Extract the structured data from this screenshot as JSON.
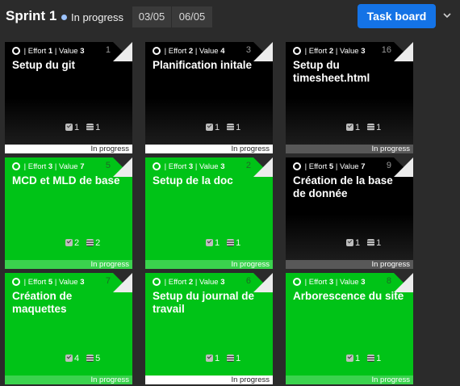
{
  "header": {
    "title": "Sprint 1",
    "status": "In progress",
    "date_start": "03/05",
    "date_end": "06/05",
    "task_board_label": "Task board"
  },
  "colors": {
    "dark_card": "#000000",
    "green_card": "#00c317",
    "button": "#1473e6"
  },
  "cards": [
    {
      "num": "1",
      "effort_label": "Effort",
      "effort": "1",
      "value_label": "Value",
      "value": "3",
      "title": "Setup du git",
      "checks": "1",
      "items": "1",
      "status": "In progress"
    },
    {
      "num": "3",
      "effort_label": "Effort",
      "effort": "2",
      "value_label": "Value",
      "value": "4",
      "title": "Planification initale",
      "checks": "1",
      "items": "1",
      "status": "In progress"
    },
    {
      "num": "16",
      "effort_label": "Effort",
      "effort": "2",
      "value_label": "Value",
      "value": "3",
      "title": "Setup du timesheet.html",
      "checks": "1",
      "items": "1",
      "status": "In progress"
    },
    {
      "num": "5",
      "effort_label": "Effort",
      "effort": "3",
      "value_label": "Value",
      "value": "7",
      "title": "MCD et MLD de base",
      "checks": "2",
      "items": "2",
      "status": "In progress"
    },
    {
      "num": "2",
      "effort_label": "Effort",
      "effort": "3",
      "value_label": "Value",
      "value": "3",
      "title": "Setup de la doc",
      "checks": "1",
      "items": "1",
      "status": "In progress"
    },
    {
      "num": "9",
      "effort_label": "Effort",
      "effort": "5",
      "value_label": "Value",
      "value": "7",
      "title": "Création de la base de donnée",
      "checks": "1",
      "items": "1",
      "status": "In progress"
    },
    {
      "num": "7",
      "effort_label": "Effort",
      "effort": "5",
      "value_label": "Value",
      "value": "3",
      "title": "Création de maquettes",
      "checks": "4",
      "items": "5",
      "status": "In progress"
    },
    {
      "num": "6",
      "effort_label": "Effort",
      "effort": "2",
      "value_label": "Value",
      "value": "3",
      "title": "Setup du journal de travail",
      "checks": "1",
      "items": "1",
      "status": "In progress"
    },
    {
      "num": "8",
      "effort_label": "Effort",
      "effort": "3",
      "value_label": "Value",
      "value": "3",
      "title": "Arborescence du site",
      "checks": "1",
      "items": "1",
      "status": "In progress"
    }
  ]
}
